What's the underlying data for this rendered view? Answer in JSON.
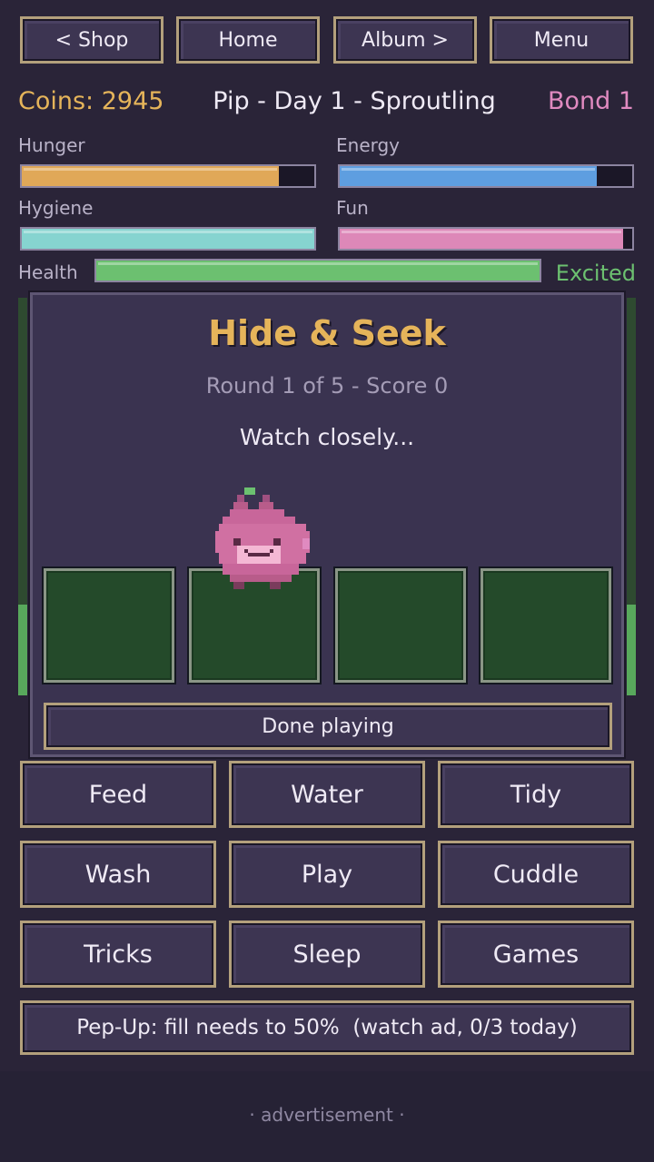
{
  "nav": {
    "shop": "< Shop",
    "home": "Home",
    "album": "Album >",
    "menu": "Menu"
  },
  "header": {
    "coins": "Coins: 2945",
    "pet_info": "Pip - Day 1 - Sproutling",
    "bond": "Bond 1"
  },
  "stats": {
    "hunger": {
      "label": "Hunger",
      "level": 0.88,
      "color": "#e0a858"
    },
    "energy": {
      "label": "Energy",
      "level": 0.88,
      "color": "#5e9ee0"
    },
    "hygiene": {
      "label": "Hygiene",
      "level": 1.0,
      "color": "#86d4d0"
    },
    "fun": {
      "label": "Fun",
      "level": 0.97,
      "color": "#dd88b8"
    },
    "health": {
      "label": "Health",
      "level": 1.0,
      "color": "#6cc070"
    },
    "mood": "Excited"
  },
  "minigame": {
    "title": "Hide & Seek",
    "round_info": "Round 1 of 5  -  Score 0",
    "status": "Watch closely...",
    "done_label": "Done playing"
  },
  "actions": [
    "Feed",
    "Water",
    "Tidy",
    "Wash",
    "Play",
    "Cuddle",
    "Tricks",
    "Sleep",
    "Games"
  ],
  "pepup": "Pep-Up: fill needs to 50%  (watch ad, 0/3 today)",
  "ad_label": "· advertisement ·",
  "colors": {
    "coins": "#e5b45a",
    "bond": "#e08ac0",
    "mood": "#6cc070",
    "pet": "#d06a9a"
  }
}
